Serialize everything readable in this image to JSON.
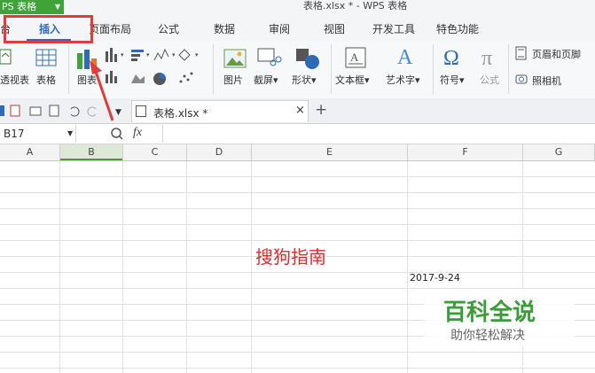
{
  "titlebar": {
    "app_label": "PS 表格",
    "document_title": "表格.xlsx * - WPS 表格"
  },
  "menu": {
    "tabs": [
      {
        "label": "台"
      },
      {
        "label": "插入"
      },
      {
        "label": "页面布局"
      },
      {
        "label": "公式"
      },
      {
        "label": "数据"
      },
      {
        "label": "审阅"
      },
      {
        "label": "视图"
      },
      {
        "label": "开发工具"
      },
      {
        "label": "特色功能"
      }
    ],
    "active_tab": "插入"
  },
  "ribbon": {
    "pivot_label": "透视表",
    "table_label": "表格",
    "chart_label": "图表",
    "picture_label": "图片",
    "screenshot_label": "截屏",
    "shape_label": "形状",
    "textbox_label": "文本框",
    "arttext_label": "艺术字",
    "symbol_label": "符号",
    "formula_label": "公式",
    "header_footer_label": "页眉和页脚",
    "camera_label": "照相机"
  },
  "docbar": {
    "tab_name": "表格.xlsx *",
    "close_symbol": "×",
    "new_symbol": "+"
  },
  "formula_bar": {
    "name_box": "B17",
    "fx": "fx"
  },
  "grid": {
    "columns": [
      "A",
      "B",
      "C",
      "D",
      "E",
      "F",
      "G"
    ],
    "cell_text": "搜狗指南",
    "date_cell": "2017-9-24"
  },
  "watermark": {
    "title": "百科全说",
    "subtitle": "助你轻松解决"
  },
  "colors": {
    "accent": "#2d6bb9",
    "app_green": "#3fa33a",
    "highlight": "#e03c3c"
  }
}
